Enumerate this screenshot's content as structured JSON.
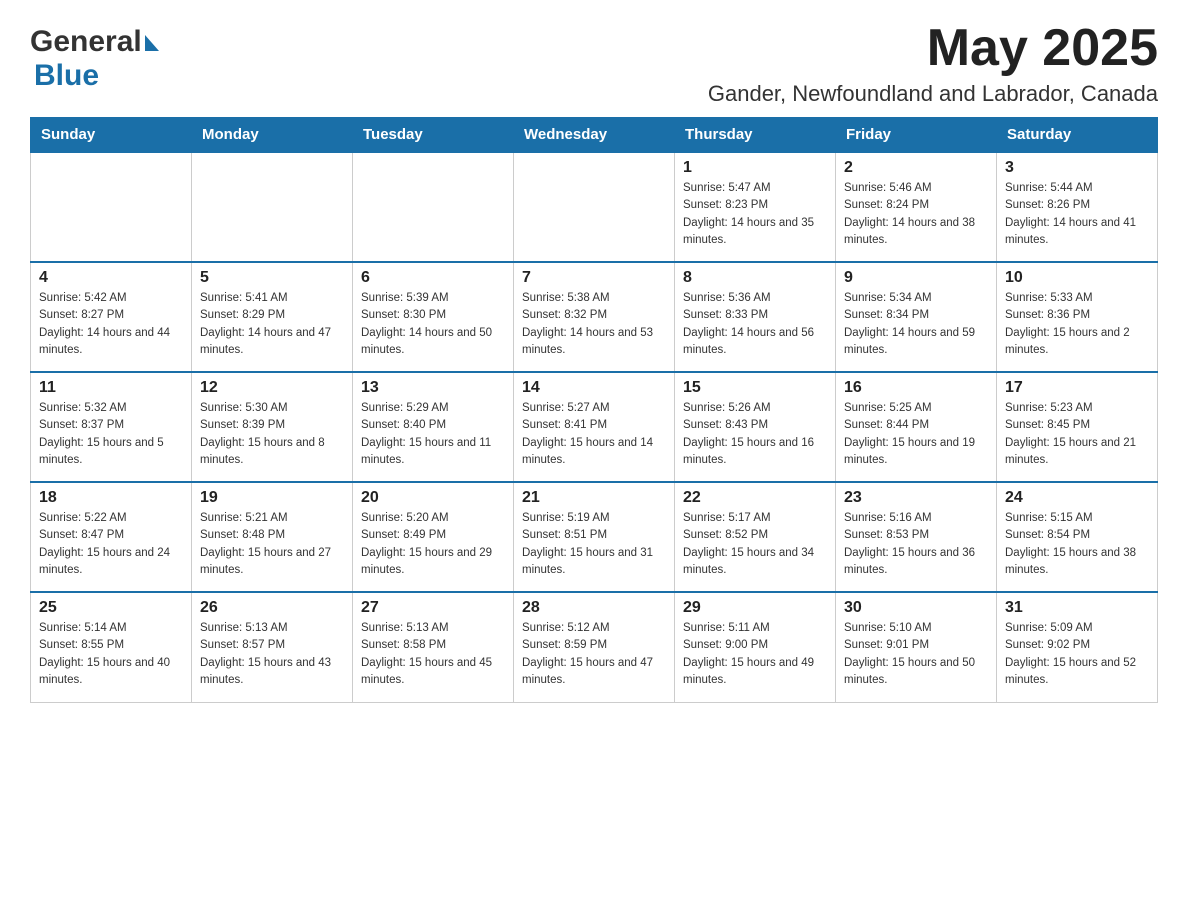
{
  "header": {
    "month_title": "May 2025",
    "location": "Gander, Newfoundland and Labrador, Canada"
  },
  "logo": {
    "general": "General",
    "blue": "Blue"
  },
  "days_of_week": [
    "Sunday",
    "Monday",
    "Tuesday",
    "Wednesday",
    "Thursday",
    "Friday",
    "Saturday"
  ],
  "weeks": [
    {
      "days": [
        {
          "number": "",
          "sunrise": "",
          "sunset": "",
          "daylight": ""
        },
        {
          "number": "",
          "sunrise": "",
          "sunset": "",
          "daylight": ""
        },
        {
          "number": "",
          "sunrise": "",
          "sunset": "",
          "daylight": ""
        },
        {
          "number": "",
          "sunrise": "",
          "sunset": "",
          "daylight": ""
        },
        {
          "number": "1",
          "sunrise": "Sunrise: 5:47 AM",
          "sunset": "Sunset: 8:23 PM",
          "daylight": "Daylight: 14 hours and 35 minutes."
        },
        {
          "number": "2",
          "sunrise": "Sunrise: 5:46 AM",
          "sunset": "Sunset: 8:24 PM",
          "daylight": "Daylight: 14 hours and 38 minutes."
        },
        {
          "number": "3",
          "sunrise": "Sunrise: 5:44 AM",
          "sunset": "Sunset: 8:26 PM",
          "daylight": "Daylight: 14 hours and 41 minutes."
        }
      ]
    },
    {
      "days": [
        {
          "number": "4",
          "sunrise": "Sunrise: 5:42 AM",
          "sunset": "Sunset: 8:27 PM",
          "daylight": "Daylight: 14 hours and 44 minutes."
        },
        {
          "number": "5",
          "sunrise": "Sunrise: 5:41 AM",
          "sunset": "Sunset: 8:29 PM",
          "daylight": "Daylight: 14 hours and 47 minutes."
        },
        {
          "number": "6",
          "sunrise": "Sunrise: 5:39 AM",
          "sunset": "Sunset: 8:30 PM",
          "daylight": "Daylight: 14 hours and 50 minutes."
        },
        {
          "number": "7",
          "sunrise": "Sunrise: 5:38 AM",
          "sunset": "Sunset: 8:32 PM",
          "daylight": "Daylight: 14 hours and 53 minutes."
        },
        {
          "number": "8",
          "sunrise": "Sunrise: 5:36 AM",
          "sunset": "Sunset: 8:33 PM",
          "daylight": "Daylight: 14 hours and 56 minutes."
        },
        {
          "number": "9",
          "sunrise": "Sunrise: 5:34 AM",
          "sunset": "Sunset: 8:34 PM",
          "daylight": "Daylight: 14 hours and 59 minutes."
        },
        {
          "number": "10",
          "sunrise": "Sunrise: 5:33 AM",
          "sunset": "Sunset: 8:36 PM",
          "daylight": "Daylight: 15 hours and 2 minutes."
        }
      ]
    },
    {
      "days": [
        {
          "number": "11",
          "sunrise": "Sunrise: 5:32 AM",
          "sunset": "Sunset: 8:37 PM",
          "daylight": "Daylight: 15 hours and 5 minutes."
        },
        {
          "number": "12",
          "sunrise": "Sunrise: 5:30 AM",
          "sunset": "Sunset: 8:39 PM",
          "daylight": "Daylight: 15 hours and 8 minutes."
        },
        {
          "number": "13",
          "sunrise": "Sunrise: 5:29 AM",
          "sunset": "Sunset: 8:40 PM",
          "daylight": "Daylight: 15 hours and 11 minutes."
        },
        {
          "number": "14",
          "sunrise": "Sunrise: 5:27 AM",
          "sunset": "Sunset: 8:41 PM",
          "daylight": "Daylight: 15 hours and 14 minutes."
        },
        {
          "number": "15",
          "sunrise": "Sunrise: 5:26 AM",
          "sunset": "Sunset: 8:43 PM",
          "daylight": "Daylight: 15 hours and 16 minutes."
        },
        {
          "number": "16",
          "sunrise": "Sunrise: 5:25 AM",
          "sunset": "Sunset: 8:44 PM",
          "daylight": "Daylight: 15 hours and 19 minutes."
        },
        {
          "number": "17",
          "sunrise": "Sunrise: 5:23 AM",
          "sunset": "Sunset: 8:45 PM",
          "daylight": "Daylight: 15 hours and 21 minutes."
        }
      ]
    },
    {
      "days": [
        {
          "number": "18",
          "sunrise": "Sunrise: 5:22 AM",
          "sunset": "Sunset: 8:47 PM",
          "daylight": "Daylight: 15 hours and 24 minutes."
        },
        {
          "number": "19",
          "sunrise": "Sunrise: 5:21 AM",
          "sunset": "Sunset: 8:48 PM",
          "daylight": "Daylight: 15 hours and 27 minutes."
        },
        {
          "number": "20",
          "sunrise": "Sunrise: 5:20 AM",
          "sunset": "Sunset: 8:49 PM",
          "daylight": "Daylight: 15 hours and 29 minutes."
        },
        {
          "number": "21",
          "sunrise": "Sunrise: 5:19 AM",
          "sunset": "Sunset: 8:51 PM",
          "daylight": "Daylight: 15 hours and 31 minutes."
        },
        {
          "number": "22",
          "sunrise": "Sunrise: 5:17 AM",
          "sunset": "Sunset: 8:52 PM",
          "daylight": "Daylight: 15 hours and 34 minutes."
        },
        {
          "number": "23",
          "sunrise": "Sunrise: 5:16 AM",
          "sunset": "Sunset: 8:53 PM",
          "daylight": "Daylight: 15 hours and 36 minutes."
        },
        {
          "number": "24",
          "sunrise": "Sunrise: 5:15 AM",
          "sunset": "Sunset: 8:54 PM",
          "daylight": "Daylight: 15 hours and 38 minutes."
        }
      ]
    },
    {
      "days": [
        {
          "number": "25",
          "sunrise": "Sunrise: 5:14 AM",
          "sunset": "Sunset: 8:55 PM",
          "daylight": "Daylight: 15 hours and 40 minutes."
        },
        {
          "number": "26",
          "sunrise": "Sunrise: 5:13 AM",
          "sunset": "Sunset: 8:57 PM",
          "daylight": "Daylight: 15 hours and 43 minutes."
        },
        {
          "number": "27",
          "sunrise": "Sunrise: 5:13 AM",
          "sunset": "Sunset: 8:58 PM",
          "daylight": "Daylight: 15 hours and 45 minutes."
        },
        {
          "number": "28",
          "sunrise": "Sunrise: 5:12 AM",
          "sunset": "Sunset: 8:59 PM",
          "daylight": "Daylight: 15 hours and 47 minutes."
        },
        {
          "number": "29",
          "sunrise": "Sunrise: 5:11 AM",
          "sunset": "Sunset: 9:00 PM",
          "daylight": "Daylight: 15 hours and 49 minutes."
        },
        {
          "number": "30",
          "sunrise": "Sunrise: 5:10 AM",
          "sunset": "Sunset: 9:01 PM",
          "daylight": "Daylight: 15 hours and 50 minutes."
        },
        {
          "number": "31",
          "sunrise": "Sunrise: 5:09 AM",
          "sunset": "Sunset: 9:02 PM",
          "daylight": "Daylight: 15 hours and 52 minutes."
        }
      ]
    }
  ]
}
